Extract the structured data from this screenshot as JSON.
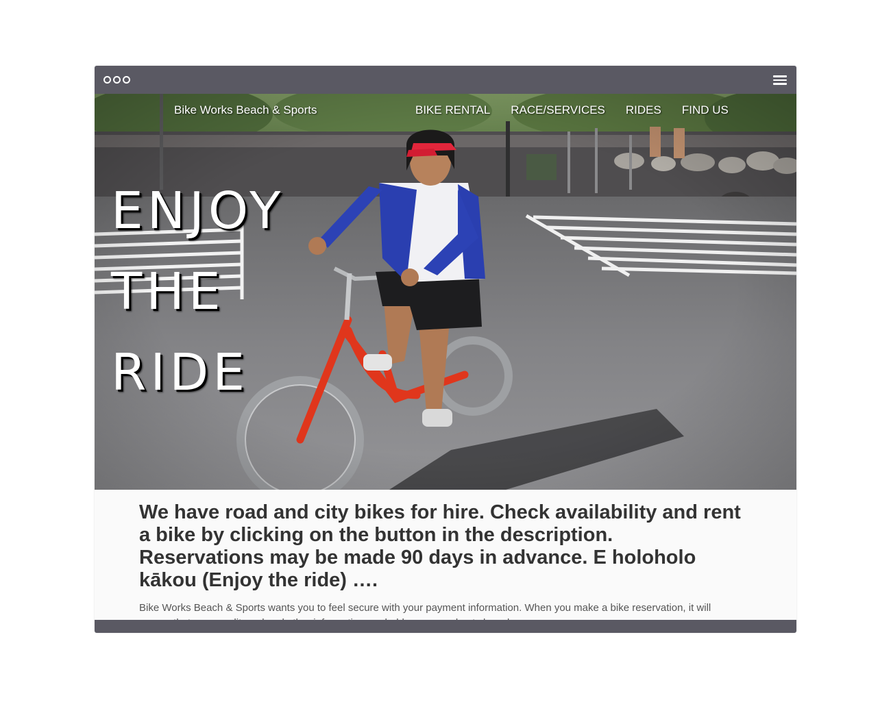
{
  "site": {
    "brand": "Bike Works Beach & Sports"
  },
  "nav": {
    "items": [
      {
        "label": "BIKE RENTAL"
      },
      {
        "label": "RACE/SERVICES"
      },
      {
        "label": "RIDES"
      },
      {
        "label": "FIND US"
      }
    ]
  },
  "hero": {
    "headline_lines": [
      "ENJOY",
      "THE",
      "RIDE"
    ]
  },
  "content": {
    "lead": "We have road and city bikes for hire. Check availability and rent a bike by clicking on the button in the description. Reservations may be made 90 days in advance. E holoholo kākou (Enjoy the ride) ….",
    "body": "Bike Works Beach & Sports wants you to feel secure with your payment information. When you make a bike reservation, it will ensure that your credit card and other information are held secure and not shared."
  },
  "colors": {
    "browser_bar": "#5a5963",
    "lead_text": "#333333",
    "body_text": "#555555",
    "content_bg": "#fafafa",
    "bike_frame": "#e0361c",
    "jersey_blue": "#2a3fb0"
  },
  "icons": {
    "window_controls": "three-circle-dots",
    "menu": "hamburger-icon"
  }
}
